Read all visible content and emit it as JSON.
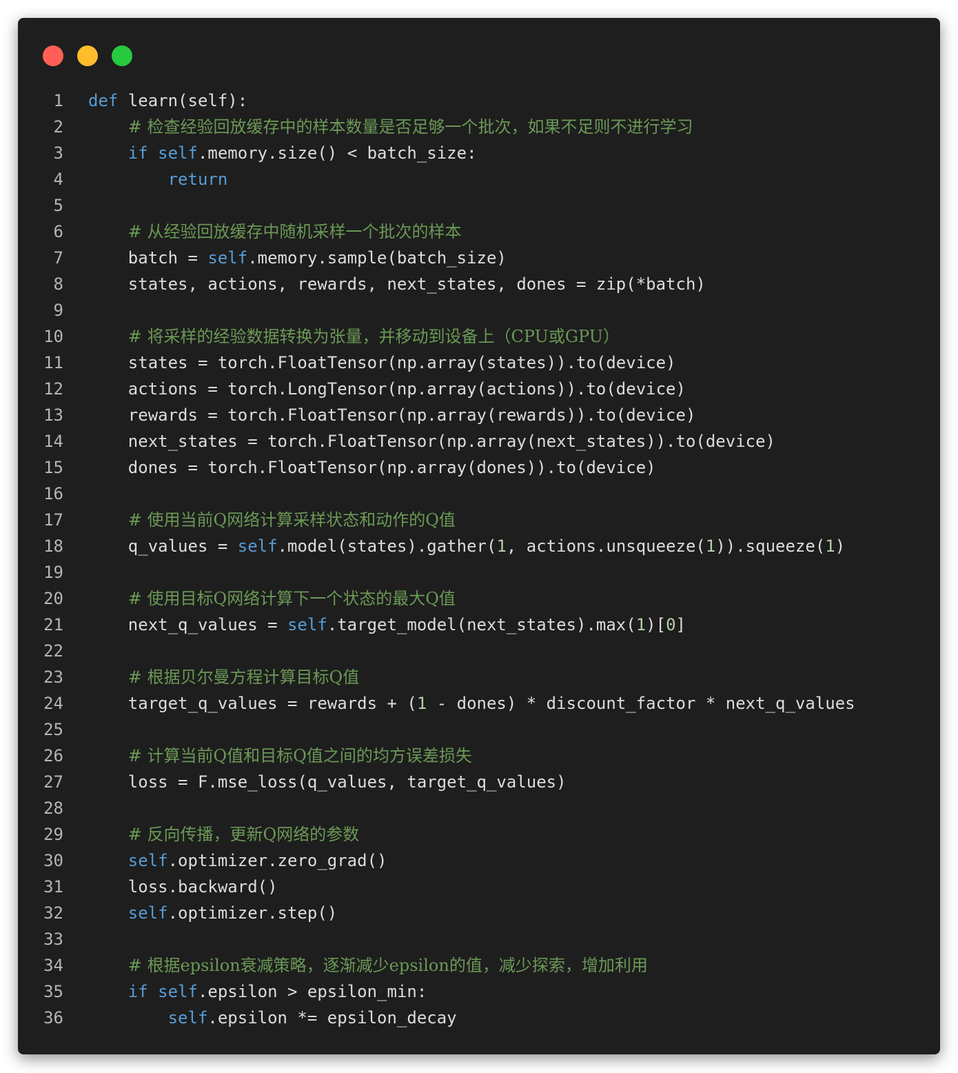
{
  "window": {
    "controls": [
      "close",
      "minimize",
      "maximize"
    ],
    "colors": {
      "background": "#1e1e1e",
      "close": "#ff5f56",
      "minimize": "#ffbd2e",
      "maximize": "#27c93f",
      "keyword": "#569cd6",
      "comment": "#6a9955",
      "number": "#b5cea8",
      "text": "#dcdcdc",
      "line_number": "#b5b5b5"
    }
  },
  "code": {
    "language": "python",
    "lines": [
      {
        "n": "1",
        "tokens": [
          {
            "t": "kw",
            "v": "def"
          },
          {
            "t": "pl",
            "v": " learn(self):"
          }
        ]
      },
      {
        "n": "2",
        "tokens": [
          {
            "t": "pl",
            "v": "    "
          },
          {
            "t": "cm",
            "v": "# 检查经验回放缓存中的样本数量是否足够一个批次，如果不足则不进行学习"
          }
        ]
      },
      {
        "n": "3",
        "tokens": [
          {
            "t": "pl",
            "v": "    "
          },
          {
            "t": "kw",
            "v": "if"
          },
          {
            "t": "pl",
            "v": " "
          },
          {
            "t": "self",
            "v": "self"
          },
          {
            "t": "pl",
            "v": ".memory.size() < batch_size:"
          }
        ]
      },
      {
        "n": "4",
        "tokens": [
          {
            "t": "pl",
            "v": "        "
          },
          {
            "t": "kw",
            "v": "return"
          }
        ]
      },
      {
        "n": "5",
        "tokens": []
      },
      {
        "n": "6",
        "tokens": [
          {
            "t": "pl",
            "v": "    "
          },
          {
            "t": "cm",
            "v": "# 从经验回放缓存中随机采样一个批次的样本"
          }
        ]
      },
      {
        "n": "7",
        "tokens": [
          {
            "t": "pl",
            "v": "    batch = "
          },
          {
            "t": "self",
            "v": "self"
          },
          {
            "t": "pl",
            "v": ".memory.sample(batch_size)"
          }
        ]
      },
      {
        "n": "8",
        "tokens": [
          {
            "t": "pl",
            "v": "    states, actions, rewards, next_states, dones = zip(*batch)"
          }
        ]
      },
      {
        "n": "9",
        "tokens": []
      },
      {
        "n": "10",
        "tokens": [
          {
            "t": "pl",
            "v": "    "
          },
          {
            "t": "cm",
            "v": "# 将采样的经验数据转换为张量，并移动到设备上（CPU或GPU）"
          }
        ]
      },
      {
        "n": "11",
        "tokens": [
          {
            "t": "pl",
            "v": "    states = torch.FloatTensor(np.array(states)).to(device)"
          }
        ]
      },
      {
        "n": "12",
        "tokens": [
          {
            "t": "pl",
            "v": "    actions = torch.LongTensor(np.array(actions)).to(device)"
          }
        ]
      },
      {
        "n": "13",
        "tokens": [
          {
            "t": "pl",
            "v": "    rewards = torch.FloatTensor(np.array(rewards)).to(device)"
          }
        ]
      },
      {
        "n": "14",
        "tokens": [
          {
            "t": "pl",
            "v": "    next_states = torch.FloatTensor(np.array(next_states)).to(device)"
          }
        ]
      },
      {
        "n": "15",
        "tokens": [
          {
            "t": "pl",
            "v": "    dones = torch.FloatTensor(np.array(dones)).to(device)"
          }
        ]
      },
      {
        "n": "16",
        "tokens": []
      },
      {
        "n": "17",
        "tokens": [
          {
            "t": "pl",
            "v": "    "
          },
          {
            "t": "cm",
            "v": "# 使用当前Q网络计算采样状态和动作的Q值"
          }
        ]
      },
      {
        "n": "18",
        "tokens": [
          {
            "t": "pl",
            "v": "    q_values = "
          },
          {
            "t": "self",
            "v": "self"
          },
          {
            "t": "pl",
            "v": ".model(states).gather("
          },
          {
            "t": "num",
            "v": "1"
          },
          {
            "t": "pl",
            "v": ", actions.unsqueeze("
          },
          {
            "t": "num",
            "v": "1"
          },
          {
            "t": "pl",
            "v": ")).squeeze("
          },
          {
            "t": "num",
            "v": "1"
          },
          {
            "t": "pl",
            "v": ")"
          }
        ]
      },
      {
        "n": "19",
        "tokens": []
      },
      {
        "n": "20",
        "tokens": [
          {
            "t": "pl",
            "v": "    "
          },
          {
            "t": "cm",
            "v": "# 使用目标Q网络计算下一个状态的最大Q值"
          }
        ]
      },
      {
        "n": "21",
        "tokens": [
          {
            "t": "pl",
            "v": "    next_q_values = "
          },
          {
            "t": "self",
            "v": "self"
          },
          {
            "t": "pl",
            "v": ".target_model(next_states).max("
          },
          {
            "t": "num",
            "v": "1"
          },
          {
            "t": "pl",
            "v": ")["
          },
          {
            "t": "num",
            "v": "0"
          },
          {
            "t": "pl",
            "v": "]"
          }
        ]
      },
      {
        "n": "22",
        "tokens": []
      },
      {
        "n": "23",
        "tokens": [
          {
            "t": "pl",
            "v": "    "
          },
          {
            "t": "cm",
            "v": "# 根据贝尔曼方程计算目标Q值"
          }
        ]
      },
      {
        "n": "24",
        "tokens": [
          {
            "t": "pl",
            "v": "    target_q_values = rewards + ("
          },
          {
            "t": "num",
            "v": "1"
          },
          {
            "t": "pl",
            "v": " - dones) * discount_factor * next_q_values"
          }
        ]
      },
      {
        "n": "25",
        "tokens": []
      },
      {
        "n": "26",
        "tokens": [
          {
            "t": "pl",
            "v": "    "
          },
          {
            "t": "cm",
            "v": "# 计算当前Q值和目标Q值之间的均方误差损失"
          }
        ]
      },
      {
        "n": "27",
        "tokens": [
          {
            "t": "pl",
            "v": "    loss = F.mse_loss(q_values, target_q_values)"
          }
        ]
      },
      {
        "n": "28",
        "tokens": []
      },
      {
        "n": "29",
        "tokens": [
          {
            "t": "pl",
            "v": "    "
          },
          {
            "t": "cm",
            "v": "# 反向传播，更新Q网络的参数"
          }
        ]
      },
      {
        "n": "30",
        "tokens": [
          {
            "t": "pl",
            "v": "    "
          },
          {
            "t": "self",
            "v": "self"
          },
          {
            "t": "pl",
            "v": ".optimizer.zero_grad()"
          }
        ]
      },
      {
        "n": "31",
        "tokens": [
          {
            "t": "pl",
            "v": "    loss.backward()"
          }
        ]
      },
      {
        "n": "32",
        "tokens": [
          {
            "t": "pl",
            "v": "    "
          },
          {
            "t": "self",
            "v": "self"
          },
          {
            "t": "pl",
            "v": ".optimizer.step()"
          }
        ]
      },
      {
        "n": "33",
        "tokens": []
      },
      {
        "n": "34",
        "tokens": [
          {
            "t": "pl",
            "v": "    "
          },
          {
            "t": "cm",
            "v": "# 根据epsilon衰减策略，逐渐减少epsilon的值，减少探索，增加利用"
          }
        ]
      },
      {
        "n": "35",
        "tokens": [
          {
            "t": "pl",
            "v": "    "
          },
          {
            "t": "kw",
            "v": "if"
          },
          {
            "t": "pl",
            "v": " "
          },
          {
            "t": "self",
            "v": "self"
          },
          {
            "t": "pl",
            "v": ".epsilon > epsilon_min:"
          }
        ]
      },
      {
        "n": "36",
        "tokens": [
          {
            "t": "pl",
            "v": "        "
          },
          {
            "t": "self",
            "v": "self"
          },
          {
            "t": "pl",
            "v": ".epsilon *= epsilon_decay"
          }
        ]
      }
    ]
  }
}
